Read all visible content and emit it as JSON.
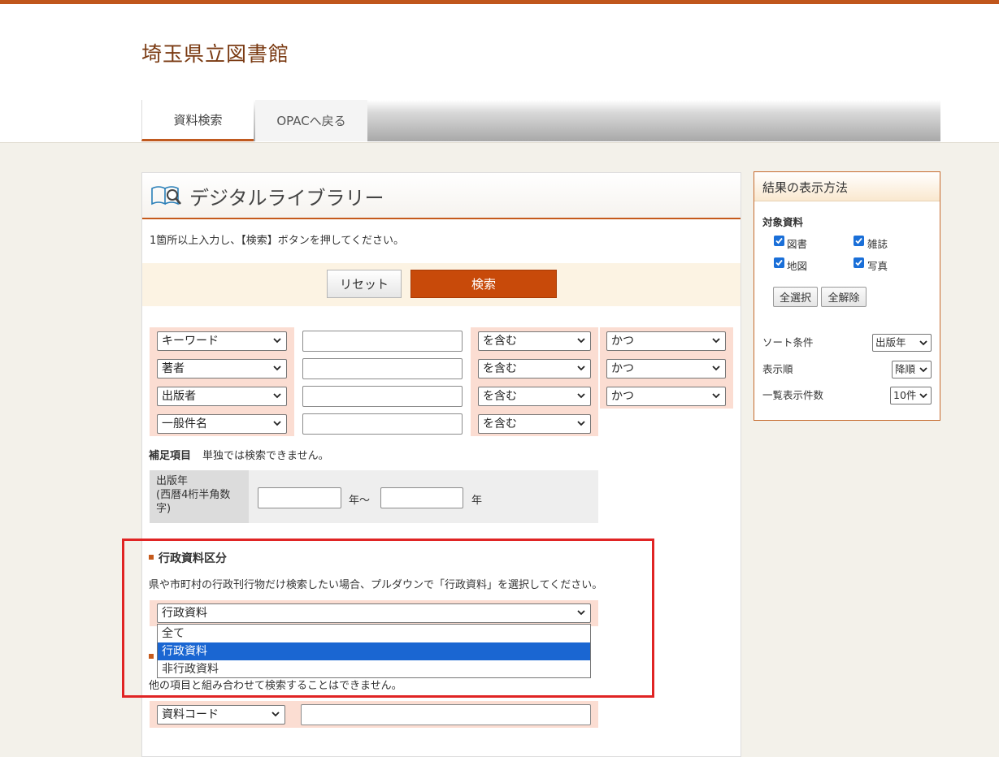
{
  "site": {
    "title": "埼玉県立図書館"
  },
  "nav": {
    "tabs": [
      "資料検索",
      "OPACへ戻る"
    ]
  },
  "main": {
    "title": "デジタルライブラリー",
    "instruction": "1箇所以上入力し、【検索】ボタンを押してください。",
    "reset_label": "リセット",
    "search_label": "検索",
    "rows": [
      {
        "field": "キーワード",
        "match": "を含む",
        "conj": "かつ"
      },
      {
        "field": "著者",
        "match": "を含む",
        "conj": "かつ"
      },
      {
        "field": "出版者",
        "match": "を含む",
        "conj": "かつ"
      },
      {
        "field": "一般件名",
        "match": "を含む",
        "conj": ""
      }
    ],
    "supplement": {
      "label": "補足項目",
      "note": "単独では検索できません。"
    },
    "year": {
      "label_lines": [
        "出版年",
        "(西暦4桁半角数",
        "字)"
      ],
      "sep": "年〜",
      "suffix": "年"
    },
    "gov": {
      "heading": "行政資料区分",
      "description": "県や市町村の行政刊行物だけ検索したい場合、プルダウンで「行政資料」を選択してください。",
      "selected": "行政資料",
      "options": [
        "全て",
        "行政資料",
        "非行政資料"
      ],
      "highlighted_index": 1
    },
    "code": {
      "note": "他の項目と組み合わせて検索することはできません。",
      "field": "資料コード"
    }
  },
  "side": {
    "title": "結果の表示方法",
    "target_label": "対象資料",
    "targets": [
      {
        "label": "図書",
        "checked": true
      },
      {
        "label": "雑誌",
        "checked": true
      },
      {
        "label": "地図",
        "checked": true
      },
      {
        "label": "写真",
        "checked": true
      }
    ],
    "select_all": "全選択",
    "clear_all": "全解除",
    "sort_label": "ソート条件",
    "sort_value": "出版年",
    "order_label": "表示順",
    "order_value": "降順",
    "count_label": "一覧表示件数",
    "count_value": "10件"
  },
  "colors": {
    "accent": "#c0561c",
    "search_button": "#c84a0a",
    "highlight": "#e02424",
    "selected_option": "#1a66d2"
  }
}
